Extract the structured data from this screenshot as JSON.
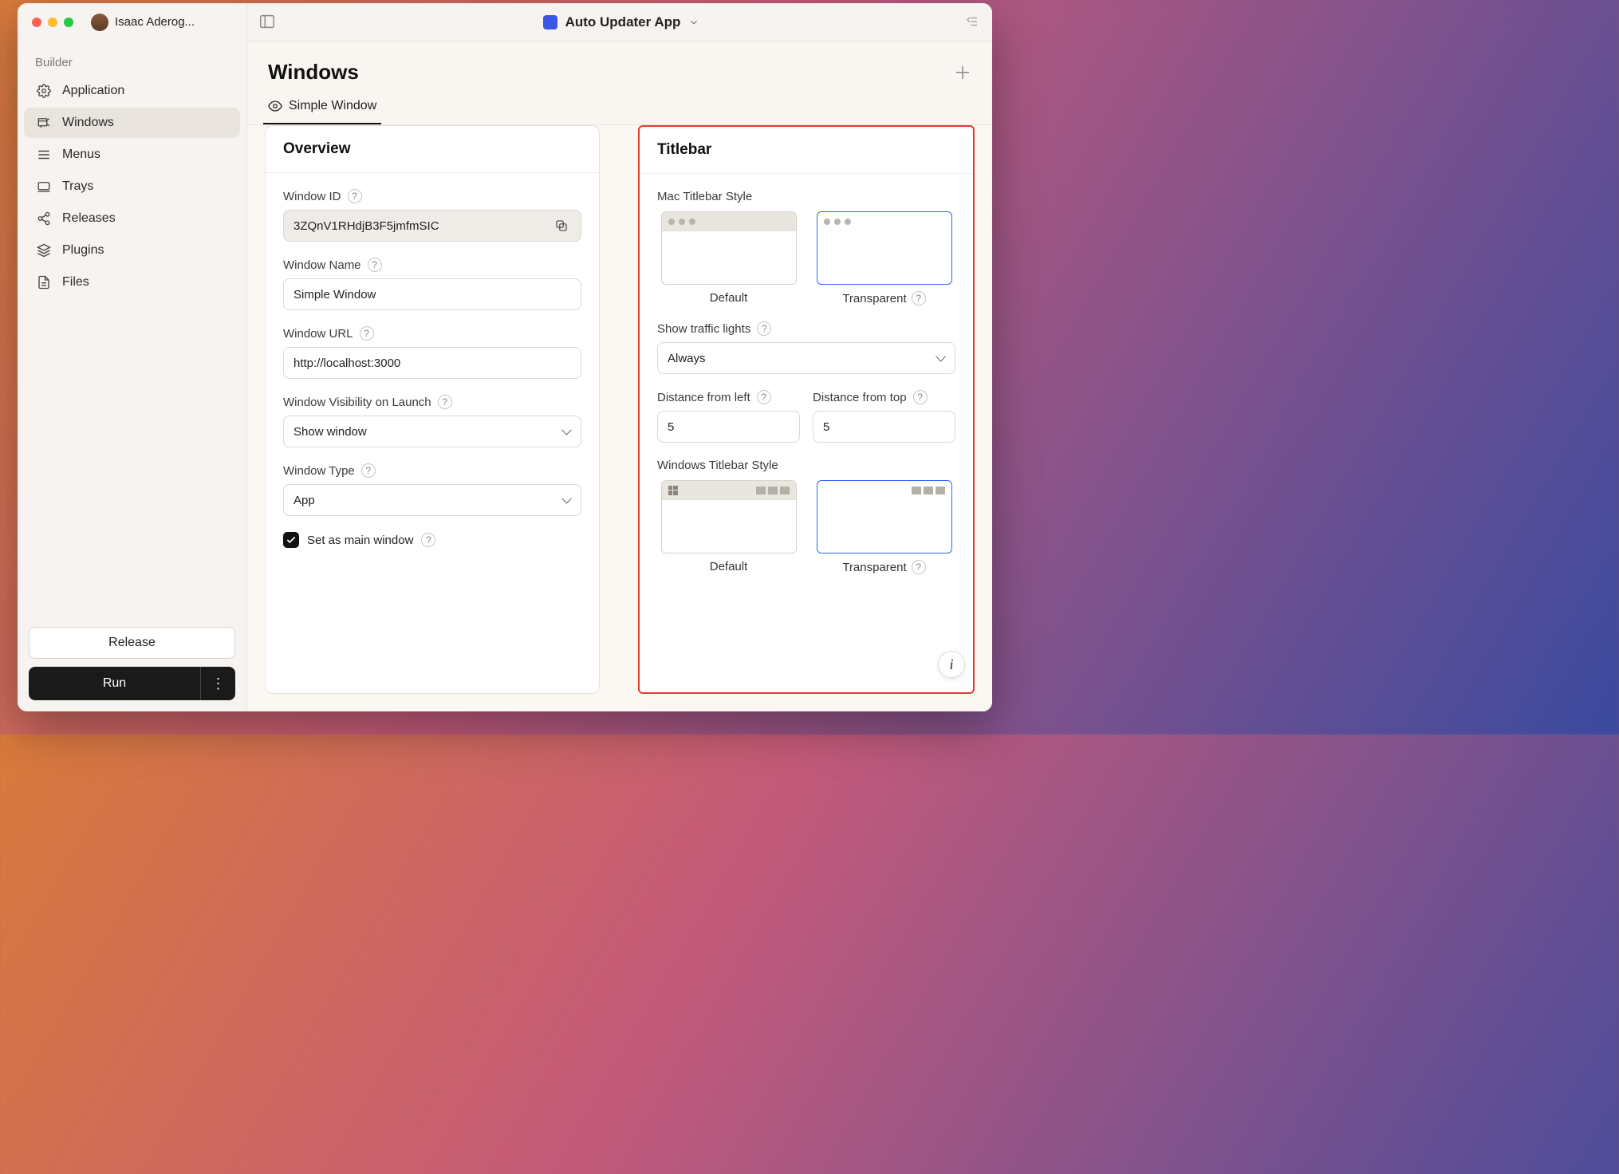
{
  "user_name": "Isaac Aderog...",
  "header_app_title": "Auto Updater App",
  "sidebar": {
    "section": "Builder",
    "items": [
      {
        "label": "Application"
      },
      {
        "label": "Windows"
      },
      {
        "label": "Menus"
      },
      {
        "label": "Trays"
      },
      {
        "label": "Releases"
      },
      {
        "label": "Plugins"
      },
      {
        "label": "Files"
      }
    ],
    "release_btn": "Release",
    "run_btn": "Run"
  },
  "page_title": "Windows",
  "tabs": [
    {
      "label": "Simple Window"
    }
  ],
  "overview": {
    "title": "Overview",
    "window_id_label": "Window ID",
    "window_id": "3ZQnV1RHdjB3F5jmfmSIC",
    "window_name_label": "Window Name",
    "window_name": "Simple Window",
    "window_url_label": "Window URL",
    "window_url": "http://localhost:3000",
    "visibility_label": "Window Visibility on Launch",
    "visibility_value": "Show window",
    "type_label": "Window Type",
    "type_value": "App",
    "main_window_label": "Set as main window"
  },
  "titlebar": {
    "title": "Titlebar",
    "mac_style_label": "Mac Titlebar Style",
    "option_default": "Default",
    "option_transparent": "Transparent",
    "traffic_label": "Show traffic lights",
    "traffic_value": "Always",
    "dist_left_label": "Distance from left",
    "dist_left_value": "5",
    "dist_top_label": "Distance from top",
    "dist_top_value": "5",
    "win_style_label": "Windows Titlebar Style"
  }
}
